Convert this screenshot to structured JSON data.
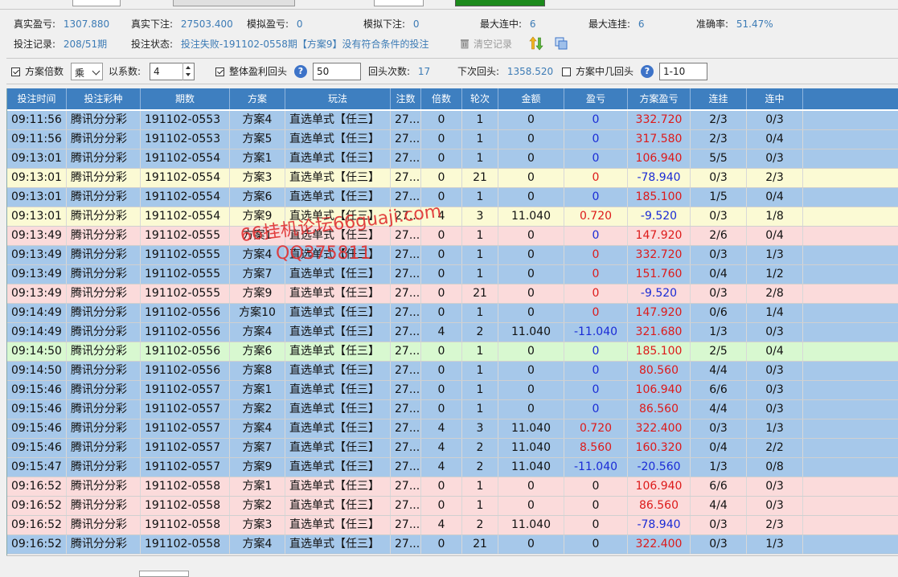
{
  "stats": {
    "real_pnl_label": "真实盈亏:",
    "real_pnl_value": "1307.880",
    "real_bet_label": "真实下注:",
    "real_bet_value": "27503.400",
    "sim_pnl_label": "模拟盈亏:",
    "sim_pnl_value": "0",
    "sim_bet_label": "模拟下注:",
    "sim_bet_value": "0",
    "max_hit_label": "最大连中:",
    "max_hit_value": "6",
    "max_miss_label": "最大连挂:",
    "max_miss_value": "6",
    "accuracy_label": "准确率:",
    "accuracy_value": "51.47%",
    "record_label": "投注记录:",
    "record_value": "208/51期",
    "status_label": "投注状态:",
    "status_value": "投注失败-191102-0558期【方案9】没有符合条件的投注",
    "clear_label": "清空记录"
  },
  "controls": {
    "plan_multiplier_label": "方案倍数",
    "plan_multiplier_checked": true,
    "op_value": "乘",
    "coef_label": "以系数:",
    "coef_value": "4",
    "profit_rollback_label": "整体盈利回头",
    "profit_rollback_checked": true,
    "profit_rollback_value": "50",
    "rollback_count_label": "回头次数:",
    "rollback_count_value": "17",
    "next_rollback_label": "下次回头:",
    "next_rollback_value": "1358.520",
    "plan_hits_label": "方案中几回头",
    "plan_hits_checked": false,
    "plan_hits_value": "1-10"
  },
  "columns": [
    "投注时间",
    "投注彩种",
    "期数",
    "方案",
    "玩法",
    "注数",
    "倍数",
    "轮次",
    "金额",
    "盈亏",
    "方案盈亏",
    "连挂",
    "连中"
  ],
  "rows": [
    {
      "color": "blue",
      "time": "09:11:56",
      "game": "腾讯分分彩",
      "period": "191102-0553",
      "plan": "方案4",
      "play": "直选单式【任三】",
      "notes": "27...",
      "mult": "0",
      "round": "1",
      "amount": "0",
      "pnl": "0",
      "pnl_c": "neg",
      "plan_pnl": "332.720",
      "plan_c": "pos",
      "streak_miss": "2/3",
      "streak_hit": "0/3"
    },
    {
      "color": "blue",
      "time": "09:11:56",
      "game": "腾讯分分彩",
      "period": "191102-0553",
      "plan": "方案5",
      "play": "直选单式【任三】",
      "notes": "27...",
      "mult": "0",
      "round": "1",
      "amount": "0",
      "pnl": "0",
      "pnl_c": "neg",
      "plan_pnl": "317.580",
      "plan_c": "pos",
      "streak_miss": "2/3",
      "streak_hit": "0/4"
    },
    {
      "color": "blue",
      "time": "09:13:01",
      "game": "腾讯分分彩",
      "period": "191102-0554",
      "plan": "方案1",
      "play": "直选单式【任三】",
      "notes": "27...",
      "mult": "0",
      "round": "1",
      "amount": "0",
      "pnl": "0",
      "pnl_c": "neg",
      "plan_pnl": "106.940",
      "plan_c": "pos",
      "streak_miss": "5/5",
      "streak_hit": "0/3"
    },
    {
      "color": "yellow",
      "time": "09:13:01",
      "game": "腾讯分分彩",
      "period": "191102-0554",
      "plan": "方案3",
      "play": "直选单式【任三】",
      "notes": "27...",
      "mult": "0",
      "round": "21",
      "amount": "0",
      "pnl": "0",
      "pnl_c": "pos",
      "plan_pnl": "-78.940",
      "plan_c": "neg",
      "streak_miss": "0/3",
      "streak_hit": "2/3"
    },
    {
      "color": "blue",
      "time": "09:13:01",
      "game": "腾讯分分彩",
      "period": "191102-0554",
      "plan": "方案6",
      "play": "直选单式【任三】",
      "notes": "27...",
      "mult": "0",
      "round": "1",
      "amount": "0",
      "pnl": "0",
      "pnl_c": "neg",
      "plan_pnl": "185.100",
      "plan_c": "pos",
      "streak_miss": "1/5",
      "streak_hit": "0/4"
    },
    {
      "color": "yellow",
      "time": "09:13:01",
      "game": "腾讯分分彩",
      "period": "191102-0554",
      "plan": "方案9",
      "play": "直选单式【任三】",
      "notes": "27...",
      "mult": "4",
      "round": "3",
      "amount": "11.040",
      "pnl": "0.720",
      "pnl_c": "pos",
      "plan_pnl": "-9.520",
      "plan_c": "neg",
      "streak_miss": "0/3",
      "streak_hit": "1/8"
    },
    {
      "color": "pink",
      "time": "09:13:49",
      "game": "腾讯分分彩",
      "period": "191102-0555",
      "plan": "方案1",
      "play": "直选单式【任三】",
      "notes": "27...",
      "mult": "0",
      "round": "1",
      "amount": "0",
      "pnl": "0",
      "pnl_c": "neg",
      "plan_pnl": "147.920",
      "plan_c": "pos",
      "streak_miss": "2/6",
      "streak_hit": "0/4"
    },
    {
      "color": "blue",
      "time": "09:13:49",
      "game": "腾讯分分彩",
      "period": "191102-0555",
      "plan": "方案4",
      "play": "直选单式【任三】",
      "notes": "27...",
      "mult": "0",
      "round": "1",
      "amount": "0",
      "pnl": "0",
      "pnl_c": "pos",
      "plan_pnl": "332.720",
      "plan_c": "pos",
      "streak_miss": "0/3",
      "streak_hit": "1/3"
    },
    {
      "color": "blue",
      "time": "09:13:49",
      "game": "腾讯分分彩",
      "period": "191102-0555",
      "plan": "方案7",
      "play": "直选单式【任三】",
      "notes": "27...",
      "mult": "0",
      "round": "1",
      "amount": "0",
      "pnl": "0",
      "pnl_c": "pos",
      "plan_pnl": "151.760",
      "plan_c": "pos",
      "streak_miss": "0/4",
      "streak_hit": "1/2"
    },
    {
      "color": "pink",
      "time": "09:13:49",
      "game": "腾讯分分彩",
      "period": "191102-0555",
      "plan": "方案9",
      "play": "直选单式【任三】",
      "notes": "27...",
      "mult": "0",
      "round": "21",
      "amount": "0",
      "pnl": "0",
      "pnl_c": "pos",
      "plan_pnl": "-9.520",
      "plan_c": "neg",
      "streak_miss": "0/3",
      "streak_hit": "2/8"
    },
    {
      "color": "blue",
      "time": "09:14:49",
      "game": "腾讯分分彩",
      "period": "191102-0556",
      "plan": "方案10",
      "play": "直选单式【任三】",
      "notes": "27...",
      "mult": "0",
      "round": "1",
      "amount": "0",
      "pnl": "0",
      "pnl_c": "pos",
      "plan_pnl": "147.920",
      "plan_c": "pos",
      "streak_miss": "0/6",
      "streak_hit": "1/4"
    },
    {
      "color": "blue",
      "time": "09:14:49",
      "game": "腾讯分分彩",
      "period": "191102-0556",
      "plan": "方案4",
      "play": "直选单式【任三】",
      "notes": "27...",
      "mult": "4",
      "round": "2",
      "amount": "11.040",
      "pnl": "-11.040",
      "pnl_c": "neg",
      "plan_pnl": "321.680",
      "plan_c": "pos",
      "streak_miss": "1/3",
      "streak_hit": "0/3"
    },
    {
      "color": "green",
      "time": "09:14:50",
      "game": "腾讯分分彩",
      "period": "191102-0556",
      "plan": "方案6",
      "play": "直选单式【任三】",
      "notes": "27...",
      "mult": "0",
      "round": "1",
      "amount": "0",
      "pnl": "0",
      "pnl_c": "neg",
      "plan_pnl": "185.100",
      "plan_c": "pos",
      "streak_miss": "2/5",
      "streak_hit": "0/4"
    },
    {
      "color": "blue",
      "time": "09:14:50",
      "game": "腾讯分分彩",
      "period": "191102-0556",
      "plan": "方案8",
      "play": "直选单式【任三】",
      "notes": "27...",
      "mult": "0",
      "round": "1",
      "amount": "0",
      "pnl": "0",
      "pnl_c": "neg",
      "plan_pnl": "80.560",
      "plan_c": "pos",
      "streak_miss": "4/4",
      "streak_hit": "0/3"
    },
    {
      "color": "blue",
      "time": "09:15:46",
      "game": "腾讯分分彩",
      "period": "191102-0557",
      "plan": "方案1",
      "play": "直选单式【任三】",
      "notes": "27...",
      "mult": "0",
      "round": "1",
      "amount": "0",
      "pnl": "0",
      "pnl_c": "neg",
      "plan_pnl": "106.940",
      "plan_c": "pos",
      "streak_miss": "6/6",
      "streak_hit": "0/3"
    },
    {
      "color": "blue",
      "time": "09:15:46",
      "game": "腾讯分分彩",
      "period": "191102-0557",
      "plan": "方案2",
      "play": "直选单式【任三】",
      "notes": "27...",
      "mult": "0",
      "round": "1",
      "amount": "0",
      "pnl": "0",
      "pnl_c": "neg",
      "plan_pnl": "86.560",
      "plan_c": "pos",
      "streak_miss": "4/4",
      "streak_hit": "0/3"
    },
    {
      "color": "blue",
      "time": "09:15:46",
      "game": "腾讯分分彩",
      "period": "191102-0557",
      "plan": "方案4",
      "play": "直选单式【任三】",
      "notes": "27...",
      "mult": "4",
      "round": "3",
      "amount": "11.040",
      "pnl": "0.720",
      "pnl_c": "pos",
      "plan_pnl": "322.400",
      "plan_c": "pos",
      "streak_miss": "0/3",
      "streak_hit": "1/3"
    },
    {
      "color": "blue",
      "time": "09:15:46",
      "game": "腾讯分分彩",
      "period": "191102-0557",
      "plan": "方案7",
      "play": "直选单式【任三】",
      "notes": "27...",
      "mult": "4",
      "round": "2",
      "amount": "11.040",
      "pnl": "8.560",
      "pnl_c": "pos",
      "plan_pnl": "160.320",
      "plan_c": "pos",
      "streak_miss": "0/4",
      "streak_hit": "2/2"
    },
    {
      "color": "blue",
      "time": "09:15:47",
      "game": "腾讯分分彩",
      "period": "191102-0557",
      "plan": "方案9",
      "play": "直选单式【任三】",
      "notes": "27...",
      "mult": "4",
      "round": "2",
      "amount": "11.040",
      "pnl": "-11.040",
      "pnl_c": "neg",
      "plan_pnl": "-20.560",
      "plan_c": "neg",
      "streak_miss": "1/3",
      "streak_hit": "0/8"
    },
    {
      "color": "pink",
      "time": "09:16:52",
      "game": "腾讯分分彩",
      "period": "191102-0558",
      "plan": "方案1",
      "play": "直选单式【任三】",
      "notes": "27...",
      "mult": "0",
      "round": "1",
      "amount": "0",
      "pnl": "0",
      "pnl_c": "none",
      "plan_pnl": "106.940",
      "plan_c": "pos",
      "streak_miss": "6/6",
      "streak_hit": "0/3"
    },
    {
      "color": "pink",
      "time": "09:16:52",
      "game": "腾讯分分彩",
      "period": "191102-0558",
      "plan": "方案2",
      "play": "直选单式【任三】",
      "notes": "27...",
      "mult": "0",
      "round": "1",
      "amount": "0",
      "pnl": "0",
      "pnl_c": "none",
      "plan_pnl": "86.560",
      "plan_c": "pos",
      "streak_miss": "4/4",
      "streak_hit": "0/3"
    },
    {
      "color": "pink",
      "time": "09:16:52",
      "game": "腾讯分分彩",
      "period": "191102-0558",
      "plan": "方案3",
      "play": "直选单式【任三】",
      "notes": "27...",
      "mult": "4",
      "round": "2",
      "amount": "11.040",
      "pnl": "0",
      "pnl_c": "none",
      "plan_pnl": "-78.940",
      "plan_c": "neg",
      "streak_miss": "0/3",
      "streak_hit": "2/3"
    },
    {
      "color": "blue",
      "time": "09:16:52",
      "game": "腾讯分分彩",
      "period": "191102-0558",
      "plan": "方案4",
      "play": "直选单式【任三】",
      "notes": "27...",
      "mult": "0",
      "round": "21",
      "amount": "0",
      "pnl": "0",
      "pnl_c": "none",
      "plan_pnl": "322.400",
      "plan_c": "pos",
      "streak_miss": "0/3",
      "streak_hit": "1/3"
    }
  ],
  "watermark": {
    "line1": "66挂机论坛66guaji.com",
    "line2": "QQ375811"
  }
}
